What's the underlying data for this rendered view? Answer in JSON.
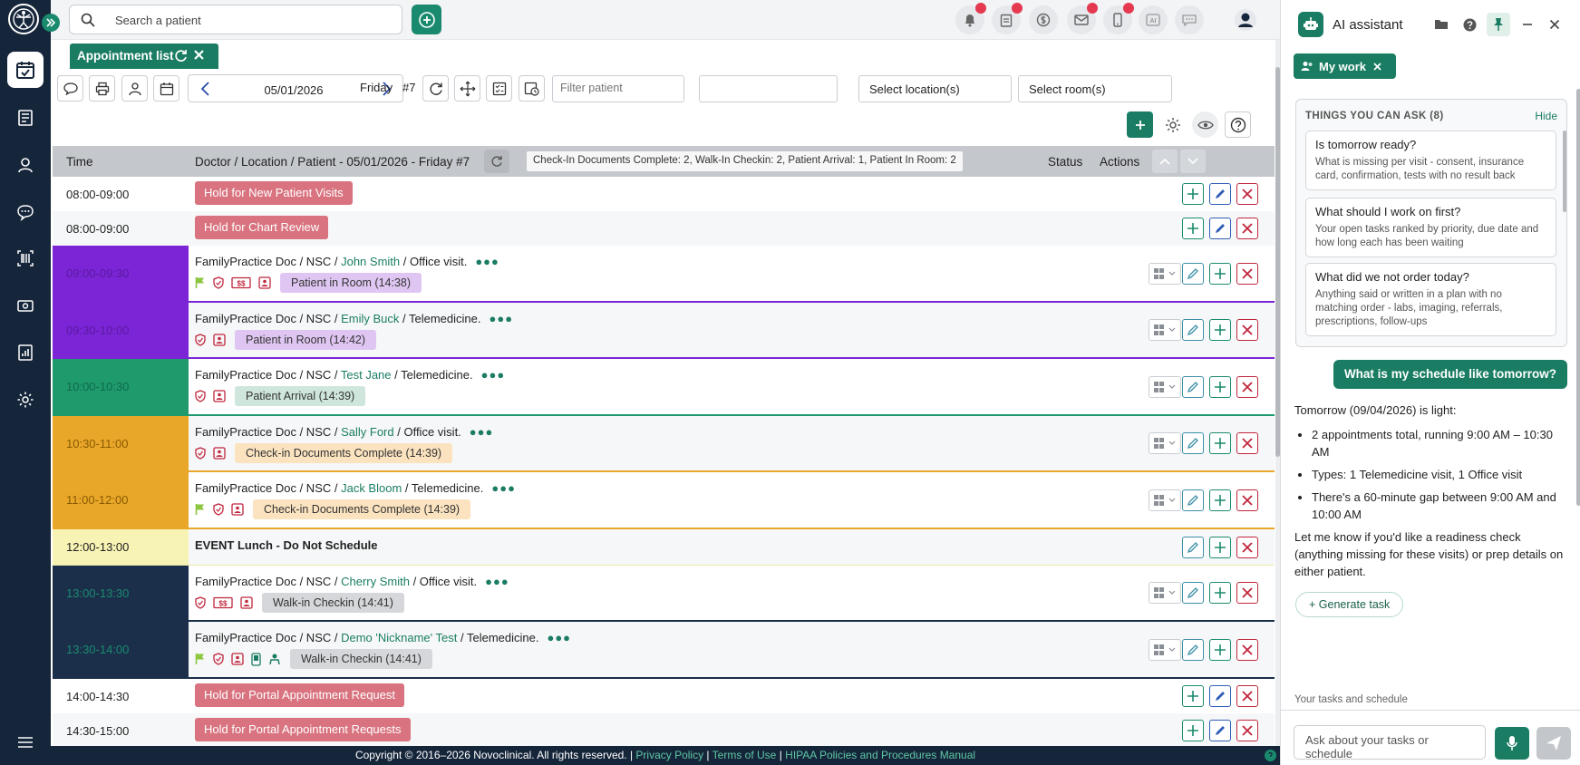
{
  "topbar": {
    "search_placeholder": "Search a patient"
  },
  "tab": {
    "label": "Appointment list"
  },
  "toolbar": {
    "date": "05/01/2026",
    "day": "Friday",
    "daynum": "#7",
    "filter_placeholder": "Filter patient",
    "location": "Select location(s)",
    "room": "Select room(s)"
  },
  "table": {
    "col_time": "Time",
    "col_main": "Doctor / Location / Patient - 05/01/2026 - Friday #7",
    "summary": "Check-In Documents Complete: 2, Walk-In Checkin: 2, Patient Arrival: 1, Patient In Room: 2",
    "col_status": "Status",
    "col_actions": "Actions",
    "rows": [
      {
        "time": "08:00-09:00",
        "hold": "Hold for New Patient Visits"
      },
      {
        "time": "08:00-09:00",
        "hold": "Hold for Chart Review"
      },
      {
        "time": "09:00-09:30",
        "prefix": "FamilyPractice Doc / NSC / ",
        "patient": "John Smith",
        "visit": " / Office visit.",
        "status": "Patient in Room (14:38)"
      },
      {
        "time": "09:30-10:00",
        "prefix": "FamilyPractice Doc / NSC / ",
        "patient": "Emily Buck",
        "visit": " / Telemedicine.",
        "status": "Patient in Room (14:42)"
      },
      {
        "time": "10:00-10:30",
        "prefix": "FamilyPractice Doc / NSC / ",
        "patient": "Test Jane",
        "visit": " / Telemedicine.",
        "status": "Patient Arrival (14:39)"
      },
      {
        "time": "10:30-11:00",
        "prefix": "FamilyPractice Doc / NSC / ",
        "patient": "Sally Ford",
        "visit": " / Office visit.",
        "status": "Check-in Documents Complete (14:39)"
      },
      {
        "time": "11:00-12:00",
        "prefix": "FamilyPractice Doc / NSC / ",
        "patient": "Jack Bloom",
        "visit": " / Telemedicine.",
        "status": "Check-in Documents Complete (14:39)"
      },
      {
        "time": "12:00-13:00",
        "event": "EVENT Lunch - Do Not Schedule"
      },
      {
        "time": "13:00-13:30",
        "prefix": "FamilyPractice Doc / NSC / ",
        "patient": "Cherry Smith",
        "visit": " / Office visit.",
        "status": "Walk-in Checkin (14:41)"
      },
      {
        "time": "13:30-14:00",
        "prefix": "FamilyPractice Doc / NSC / ",
        "patient": "Demo 'Nickname' Test",
        "visit": " / Telemedicine.",
        "status": "Walk-in Checkin (14:41)"
      },
      {
        "time": "14:00-14:30",
        "hold": "Hold for Portal Appointment Request"
      },
      {
        "time": "14:30-15:00",
        "hold": "Hold for Portal Appointment Requests"
      }
    ]
  },
  "footer": {
    "copyright": "Copyright © 2016–2026 Novoclinical. All rights reserved. | ",
    "privacy": "Privacy Policy",
    "sep1": " | ",
    "terms": "Terms of Use",
    "sep2": " | ",
    "hipaa": "HIPAA Policies and Procedures Manual"
  },
  "ai": {
    "title": "AI assistant",
    "chip": "My work",
    "ask_header": "THINGS YOU CAN ASK (8)",
    "hide": "Hide",
    "questions": [
      {
        "q": "Is tomorrow ready?",
        "d": "What is missing per visit - consent, insurance card, confirmation, tests with no result back"
      },
      {
        "q": "What should I work on first?",
        "d": "Your open tasks ranked by priority, due date and how long each has been waiting"
      },
      {
        "q": "What did we not order today?",
        "d": "Anything said or written in a plan with no matching order - labs, imaging, referrals, prescriptions, follow-ups"
      }
    ],
    "user_message": "What is my schedule like tomorrow?",
    "reply_intro": "Tomorrow (09/04/2026) is light:",
    "reply_items": [
      "2 appointments total, running 9:00 AM – 10:30 AM",
      "Types: 1 Telemedicine visit, 1 Office visit",
      "There's a 60-minute gap between 9:00 AM and 10:00 AM"
    ],
    "reply_outro": "Let me know if you'd like a readiness check (anything missing for these visits) or prep details on either patient.",
    "generate": "Generate task",
    "context_label": "Your tasks and schedule",
    "input_placeholder": "Ask about your tasks or schedule"
  },
  "colors": {
    "rail": "#15253a",
    "brand": "#1a7d63",
    "hold": "#d8737f",
    "purple": "#7b25d6",
    "green": "#1f9a6d",
    "orange": "#e9a72a",
    "lunch": "#f7f3b5",
    "navy": "#1b2f4b",
    "danger": "#c0263c"
  }
}
